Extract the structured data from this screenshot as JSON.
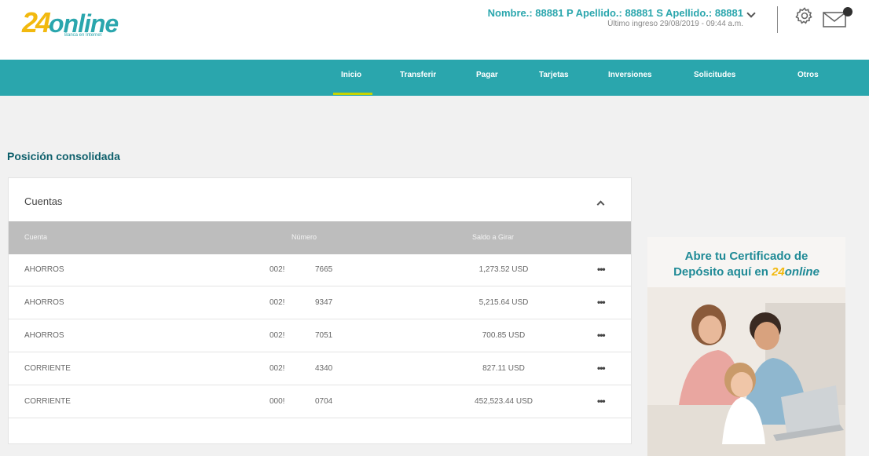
{
  "header": {
    "logo_num": "24",
    "logo_word": "online",
    "logo_tagline": "Banca en Internet",
    "user_name": "Nombre.: 88881 P Apellido.: 88881 S Apellido.: 88881",
    "last_login": "Último ingreso 29/08/2019 - 09:44 a.m."
  },
  "nav": {
    "items": [
      "Inicio",
      "Transferir",
      "Pagar",
      "Tarjetas",
      "Inversiones",
      "Solicitudes",
      "Otros"
    ],
    "active": "Inicio"
  },
  "page": {
    "title": "Posición consolidada"
  },
  "accounts": {
    "title": "Cuentas",
    "columns": [
      "Cuenta",
      "Número",
      "Saldo a Girar"
    ],
    "more_label": "•••",
    "rows": [
      {
        "type": "AHORROS",
        "num_prefix": "002!",
        "num_suffix": "7665",
        "balance": "1,273.52 USD"
      },
      {
        "type": "AHORROS",
        "num_prefix": "002!",
        "num_suffix": "9347",
        "balance": "5,215.64 USD"
      },
      {
        "type": "AHORROS",
        "num_prefix": "002!",
        "num_suffix": "7051",
        "balance": "700.85 USD"
      },
      {
        "type": "CORRIENTE",
        "num_prefix": "002!",
        "num_suffix": "4340",
        "balance": "827.11 USD"
      },
      {
        "type": "CORRIENTE",
        "num_prefix": "000!",
        "num_suffix": "0704",
        "balance": "452,523.44 USD"
      }
    ]
  },
  "promo": {
    "line1": "Abre tu Certificado de",
    "line2_prefix": "Depósito aquí en ",
    "brand_num": "24",
    "brand_word": "online"
  },
  "colors": {
    "brand_teal": "#2aa6ad",
    "brand_yellow": "#f2b90f",
    "nav_active_underline": "#c8d400",
    "title_dark_teal": "#0d5f6b",
    "table_header_gray": "#bdbdbd"
  },
  "icons": [
    "chevron-down-icon",
    "gear-icon",
    "mail-icon",
    "chevron-up-icon",
    "more-options-icon"
  ]
}
